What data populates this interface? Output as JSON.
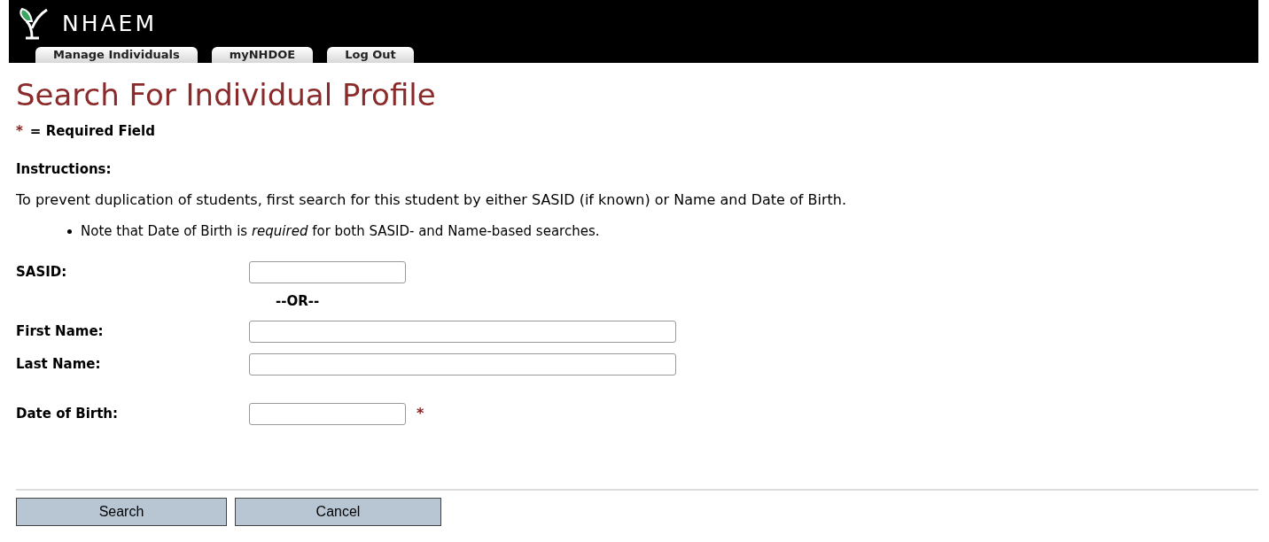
{
  "header": {
    "logo_text": "NHAEM"
  },
  "tabs": [
    "Manage Individuals",
    "myNHDOE",
    "Log Out"
  ],
  "title": "Search For Individual Profile",
  "required_legend": {
    "mark": "*",
    "text": "= Required Field"
  },
  "instructions": {
    "heading": "Instructions:",
    "text": "To prevent duplication of students, first search for this student by either SASID (if known) or Name and Date of Birth.",
    "bullets": [
      "Note that Date of Birth is *required* for both SASID- and Name-based searches."
    ]
  },
  "fields": [
    {
      "kind": "short",
      "label": "SASID:",
      "required": false
    },
    {
      "kind": "separator",
      "label": "--OR--"
    },
    {
      "kind": "long",
      "label": "First Name:",
      "required": false
    },
    {
      "kind": "long",
      "label": "Last Name:",
      "required": false
    },
    {
      "kind": "short",
      "label": "Date of Birth:",
      "required": true
    }
  ],
  "buttons": [
    "Search",
    "Cancel"
  ]
}
